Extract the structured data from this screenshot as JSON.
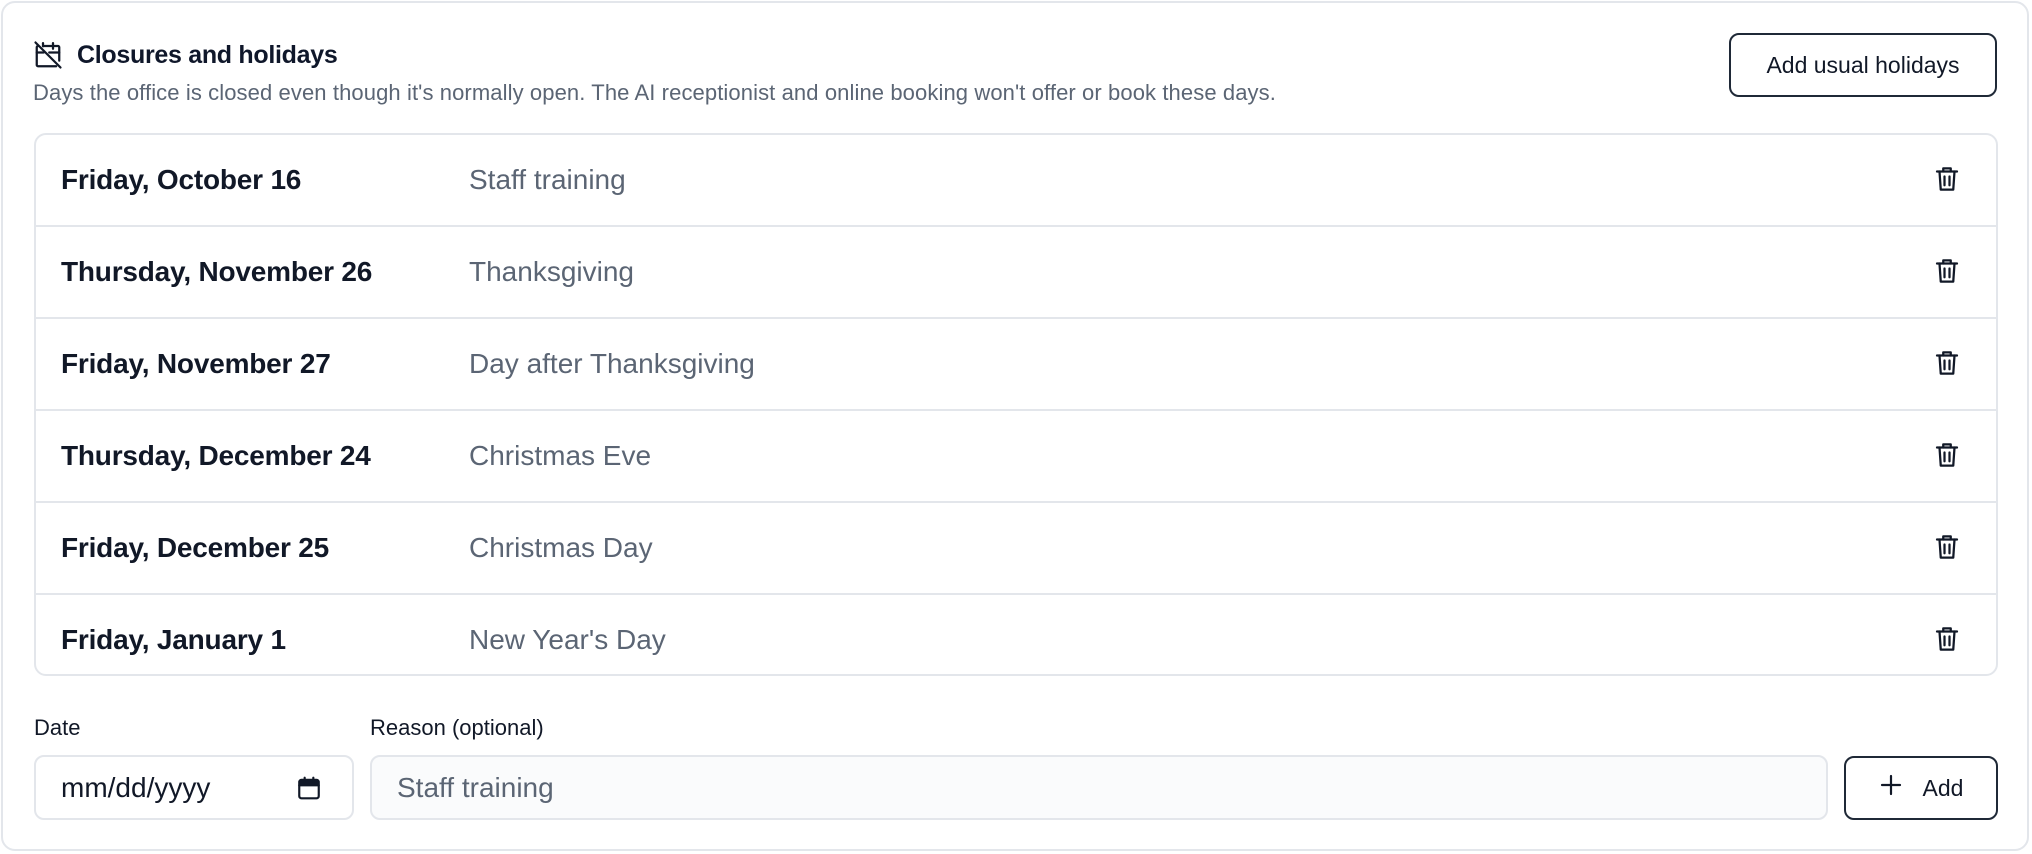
{
  "section": {
    "title": "Closures and holidays",
    "subtitle": "Days the office is closed even though it's normally open. The AI receptionist and online booking won't offer or book these days.",
    "icon": "calendar-off-icon",
    "add_usual_label": "Add usual holidays"
  },
  "closures": [
    {
      "date": "Friday, October 16",
      "reason": "Staff training",
      "delete_icon": "trash-icon"
    },
    {
      "date": "Thursday, November 26",
      "reason": "Thanksgiving",
      "delete_icon": "trash-icon"
    },
    {
      "date": "Friday, November 27",
      "reason": "Day after Thanksgiving",
      "delete_icon": "trash-icon"
    },
    {
      "date": "Thursday, December 24",
      "reason": "Christmas Eve",
      "delete_icon": "trash-icon"
    },
    {
      "date": "Friday, December 25",
      "reason": "Christmas Day",
      "delete_icon": "trash-icon"
    },
    {
      "date": "Friday, January 1",
      "reason": "New Year's Day",
      "delete_icon": "trash-icon"
    }
  ],
  "form": {
    "date_label": "Date",
    "date_placeholder": "mm/dd/yyyy",
    "reason_label": "Reason (optional)",
    "reason_placeholder": "Staff training",
    "add_label": "Add",
    "add_icon": "plus-icon"
  },
  "colors": {
    "border": "#e3e6eb",
    "text_primary": "#111827",
    "text_secondary": "#5b6574",
    "button_border": "#1f2937"
  }
}
